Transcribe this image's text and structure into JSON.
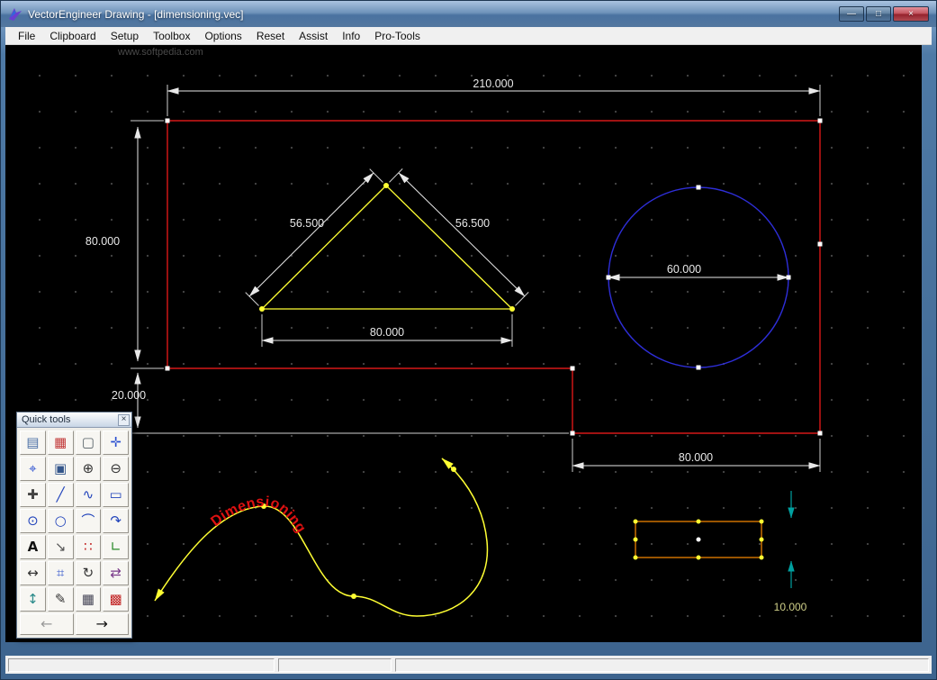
{
  "window": {
    "title": "VectorEngineer Drawing - [dimensioning.vec]",
    "controls": {
      "minimize": "—",
      "maximize": "□",
      "close": "×"
    }
  },
  "menu": {
    "items": [
      "File",
      "Clipboard",
      "Setup",
      "Toolbox",
      "Options",
      "Reset",
      "Assist",
      "Info",
      "Pro-Tools"
    ]
  },
  "canvas": {
    "watermark": "www.softpedia.com",
    "labels": {
      "dim_top": "210.000",
      "dim_left": "80.000",
      "dim_left_lower": "20.000",
      "dim_tri_left": "56.500",
      "dim_tri_right": "56.500",
      "dim_tri_base": "80.000",
      "dim_circle": "60.000",
      "dim_bottom": "80.000",
      "dim_small": "10.000",
      "curve_text": "Dimensioning"
    },
    "colors": {
      "outline": "#ff1c1c",
      "triangle": "#ffff33",
      "circle": "#2e2ed8",
      "dimension": "#e8e8e8",
      "small_rect": "#ff8c00",
      "small_dim": "#00a0a0",
      "curve": "#ffff33",
      "curve_label": "#dd1111"
    }
  },
  "quicktools": {
    "title": "Quick tools",
    "close": "×",
    "tools": [
      {
        "name": "layers",
        "glyph": "▤",
        "style": "color:#4a6fa5"
      },
      {
        "name": "colors",
        "glyph": "▦",
        "style": "color:#c23a3a"
      },
      {
        "name": "new-page",
        "glyph": "▢",
        "style": "color:#556066"
      },
      {
        "name": "move",
        "glyph": "✛",
        "style": "color:#2a4fd0"
      },
      {
        "name": "pan",
        "glyph": "⌖",
        "style": "color:#2a4fd0"
      },
      {
        "name": "zoom-window",
        "glyph": "▣",
        "style": "color:#33558a"
      },
      {
        "name": "zoom-in",
        "glyph": "⊕",
        "style": "color:#333333"
      },
      {
        "name": "zoom-out",
        "glyph": "⊖",
        "style": "color:#333333"
      },
      {
        "name": "point",
        "glyph": "✚",
        "style": "color:#444444"
      },
      {
        "name": "line",
        "glyph": "╱",
        "style": "color:#2244bb"
      },
      {
        "name": "polyline",
        "glyph": "∿",
        "style": "color:#2244bb"
      },
      {
        "name": "rectangle",
        "glyph": "▭",
        "style": "color:#2244bb"
      },
      {
        "name": "circle-center",
        "glyph": "⊙",
        "style": "color:#2244bb"
      },
      {
        "name": "circle",
        "glyph": "○",
        "style": "color:#2244bb"
      },
      {
        "name": "arc",
        "glyph": "⌒",
        "style": "color:#2244bb"
      },
      {
        "name": "arc-3pt",
        "glyph": "↷",
        "style": "color:#2244bb"
      },
      {
        "name": "text",
        "glyph": "A",
        "style": "color:#111111;font-weight:bold"
      },
      {
        "name": "offset",
        "glyph": "↘",
        "style": "color:#555555"
      },
      {
        "name": "nodes",
        "glyph": "∷",
        "style": "color:#c22222"
      },
      {
        "name": "node-edit",
        "glyph": "∟",
        "style": "color:#2a8a2a"
      },
      {
        "name": "dim-horizontal",
        "glyph": "↔",
        "style": "color:#333333"
      },
      {
        "name": "dim-leader",
        "glyph": "⌗",
        "style": "color:#3355cc"
      },
      {
        "name": "rotate",
        "glyph": "↻",
        "style": "color:#333333"
      },
      {
        "name": "mirror",
        "glyph": "⇄",
        "style": "color:#7a3a8a"
      },
      {
        "name": "dim-vertical",
        "glyph": "↕",
        "style": "color:#2a8a8a"
      },
      {
        "name": "pen",
        "glyph": "✎",
        "style": "color:#333333"
      },
      {
        "name": "table",
        "glyph": "▦",
        "style": "color:#444455"
      },
      {
        "name": "hatch",
        "glyph": "▩",
        "style": "color:#c22222"
      }
    ],
    "nav": [
      {
        "name": "back",
        "glyph": "←",
        "style": "color:#9a9a9a"
      },
      {
        "name": "forward",
        "glyph": "→",
        "style": "color:#111111"
      }
    ]
  },
  "statusbar": {
    "panels": [
      "",
      "",
      ""
    ]
  }
}
